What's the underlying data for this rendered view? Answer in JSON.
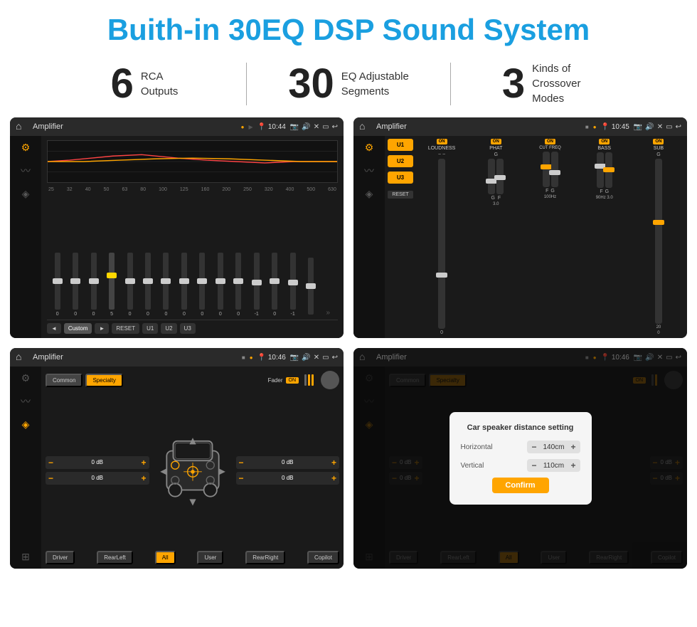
{
  "page": {
    "title": "Buith-in 30EQ DSP Sound System",
    "stats": [
      {
        "number": "6",
        "text": "RCA\nOutputs"
      },
      {
        "number": "30",
        "text": "EQ Adjustable\nSegments"
      },
      {
        "number": "3",
        "text": "Kinds of\nCrossover Modes"
      }
    ]
  },
  "screens": [
    {
      "id": "eq-screen",
      "topbar": {
        "title": "Amplifier",
        "time": "10:44"
      },
      "type": "eq",
      "freqs": [
        "25",
        "32",
        "40",
        "50",
        "63",
        "80",
        "100",
        "125",
        "160",
        "200",
        "250",
        "320",
        "400",
        "500",
        "630"
      ],
      "values": [
        "0",
        "0",
        "0",
        "5",
        "0",
        "0",
        "0",
        "0",
        "0",
        "0",
        "0",
        "-1",
        "0",
        "-1",
        ""
      ],
      "bottomBtns": [
        "◄",
        "Custom",
        "►",
        "RESET",
        "U1",
        "U2",
        "U3"
      ]
    },
    {
      "id": "dsp-screen",
      "topbar": {
        "title": "Amplifier",
        "time": "10:45"
      },
      "type": "dsp",
      "modes": [
        "U1",
        "U2",
        "U3"
      ],
      "channels": [
        "LOUDNESS",
        "PHAT",
        "CUT FREQ",
        "BASS",
        "SUB"
      ]
    },
    {
      "id": "fader-screen",
      "topbar": {
        "title": "Amplifier",
        "time": "10:46"
      },
      "type": "fader",
      "tabs": [
        "Common",
        "Specialty"
      ],
      "faderLabel": "Fader",
      "faderOn": "ON",
      "dbValues": [
        "0 dB",
        "0 dB",
        "0 dB",
        "0 dB"
      ],
      "bottomBtns": [
        "Driver",
        "RearLeft",
        "All",
        "User",
        "RearRight",
        "Copilot"
      ]
    },
    {
      "id": "dialog-screen",
      "topbar": {
        "title": "Amplifier",
        "time": "10:46"
      },
      "type": "fader-dialog",
      "tabs": [
        "Common",
        "Specialty"
      ],
      "dialog": {
        "title": "Car speaker distance setting",
        "rows": [
          {
            "label": "Horizontal",
            "value": "140cm"
          },
          {
            "label": "Vertical",
            "value": "110cm"
          }
        ],
        "confirmLabel": "Confirm"
      }
    }
  ]
}
